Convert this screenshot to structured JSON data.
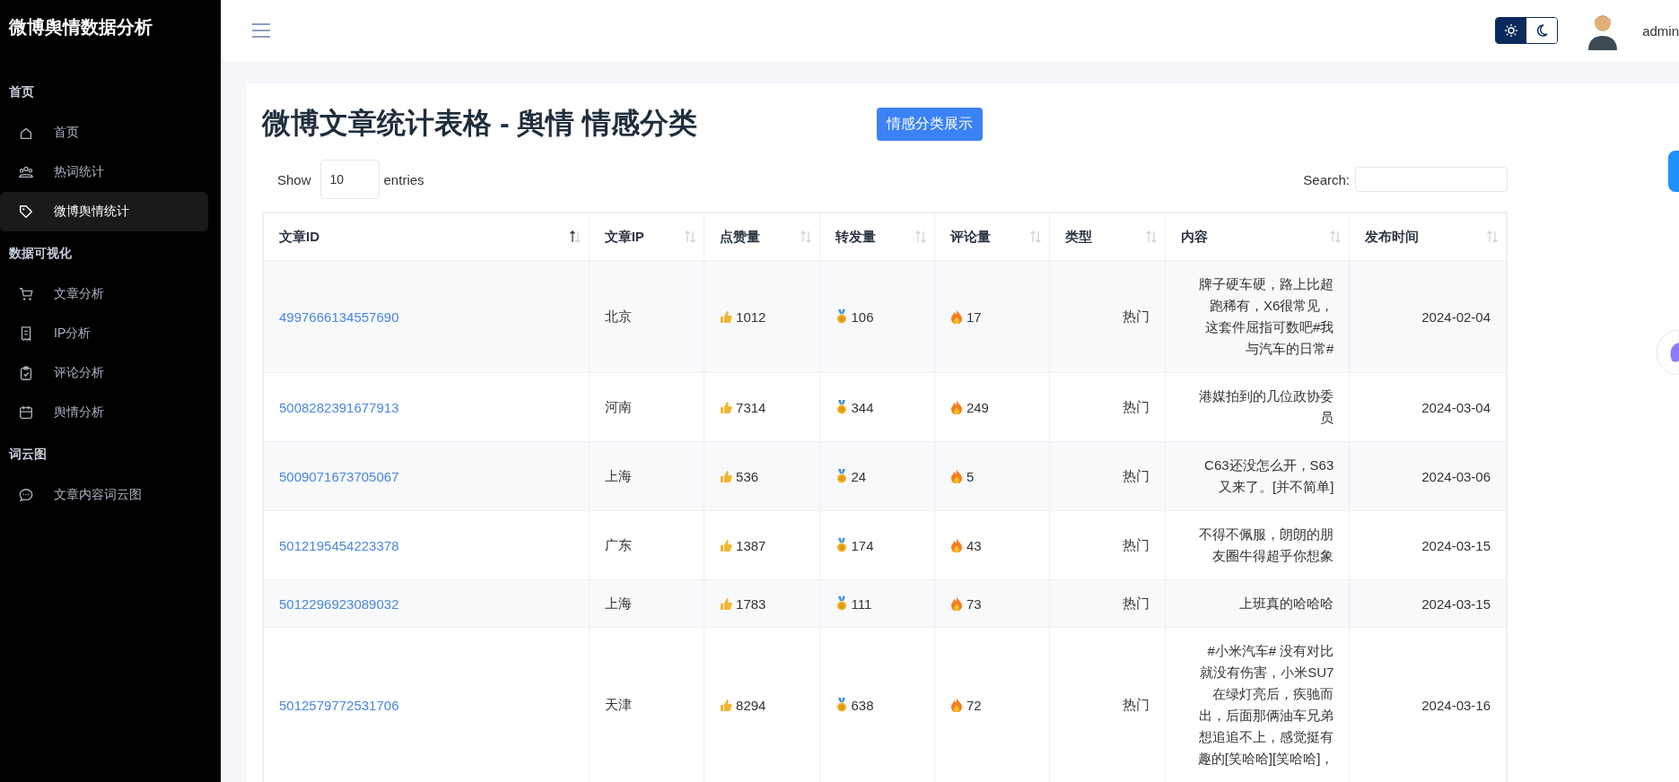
{
  "sidebar": {
    "title": "微博舆情数据分析",
    "sections": [
      {
        "heading": "首页",
        "items": [
          {
            "label": "首页",
            "selected": false
          },
          {
            "label": "热词统计",
            "selected": false
          },
          {
            "label": "微博舆情统计",
            "selected": true
          }
        ]
      },
      {
        "heading": "数据可视化",
        "items": [
          {
            "label": "文章分析",
            "selected": false
          },
          {
            "label": "IP分析",
            "selected": false
          },
          {
            "label": "评论分析",
            "selected": false
          },
          {
            "label": "舆情分析",
            "selected": false
          }
        ]
      },
      {
        "heading": "词云图",
        "items": [
          {
            "label": "文章内容词云图",
            "selected": false
          }
        ]
      }
    ]
  },
  "header": {
    "theme_toggle": [
      {
        "selected": true
      },
      {
        "selected": false
      }
    ],
    "user": "admin"
  },
  "page": {
    "title": "微博文章统计表格 - 舆情 情感分类",
    "button": "情感分类展示"
  },
  "table_controls": {
    "show_label": "Show",
    "page_size": "10",
    "entries_label": "entries",
    "search_label": "Search:"
  },
  "table": {
    "columns": [
      {
        "label": "文章ID",
        "sorted": true
      },
      {
        "label": "文章IP",
        "sorted": false
      },
      {
        "label": "点赞量",
        "sorted": false
      },
      {
        "label": "转发量",
        "sorted": false
      },
      {
        "label": "评论量",
        "sorted": false
      },
      {
        "label": "类型",
        "sorted": false
      },
      {
        "label": "内容",
        "sorted": false
      },
      {
        "label": "发布时间",
        "sorted": false
      }
    ],
    "rows": [
      [
        "4997666134557690",
        "北京",
        "1012",
        "106",
        "17",
        "热门",
        "牌子硬车硬，路上比超跑稀有，X6很常见，这套件屈指可数吧#我与汽车的日常#",
        "2024-02-04"
      ],
      [
        "5008282391677913",
        "河南",
        "7314",
        "344",
        "249",
        "热门",
        "港媒拍到的几位政协委员",
        "2024-03-04"
      ],
      [
        "5009071673705067",
        "上海",
        "536",
        "24",
        "5",
        "热门",
        "C63还没怎么开，S63又来了。[并不简单]",
        "2024-03-06"
      ],
      [
        "5012195454223378",
        "广东",
        "1387",
        "174",
        "43",
        "热门",
        "不得不佩服，朗朗的朋友圈牛得超乎你想象",
        "2024-03-15"
      ],
      [
        "5012296923089032",
        "上海",
        "1783",
        "111",
        "73",
        "热门",
        "上班真的哈哈哈",
        "2024-03-15"
      ],
      [
        "5012579772531706",
        "天津",
        "8294",
        "638",
        "72",
        "热门",
        "#小米汽车# 没有对比就没有伤害，小米SU7 在绿灯亮后，疾驰而出，后面那俩油车兄弟想追追不上，感觉挺有趣的[笑哈哈][笑哈哈]，",
        "2024-03-16"
      ]
    ]
  }
}
